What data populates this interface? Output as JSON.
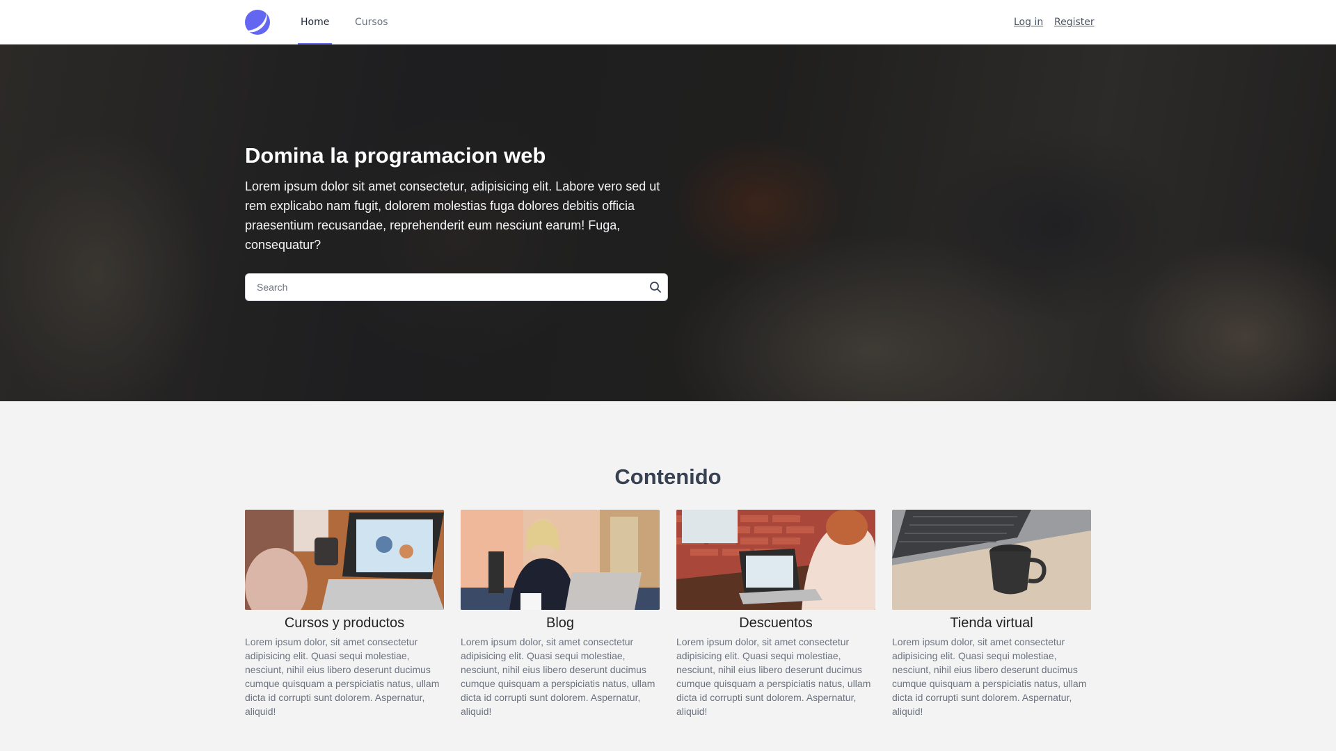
{
  "nav": {
    "items": [
      {
        "label": "Home",
        "active": true
      },
      {
        "label": "Cursos",
        "active": false
      }
    ],
    "login_label": "Log in",
    "register_label": "Register"
  },
  "hero": {
    "title": "Domina la programacion web",
    "description": "Lorem ipsum dolor sit amet consectetur, adipisicing elit. Labore vero sed ut rem explicabo nam fugit, dolorem molestias fuga dolores debitis officia praesentium recusandae, reprehenderit eum nesciunt earum! Fuga, consequatur?",
    "search": {
      "placeholder": "Search",
      "value": ""
    }
  },
  "content": {
    "title": "Contenido",
    "cards": [
      {
        "title": "Cursos y productos",
        "text": "Lorem ipsum dolor, sit amet consectetur adipisicing elit. Quasi sequi molestiae, nesciunt, nihil eius libero deserunt ducimus cumque quisquam a perspiciatis natus, ullam dicta id corrupti sunt dolorem. Aspernatur, aliquid!"
      },
      {
        "title": "Blog",
        "text": "Lorem ipsum dolor, sit amet consectetur adipisicing elit. Quasi sequi molestiae, nesciunt, nihil eius libero deserunt ducimus cumque quisquam a perspiciatis natus, ullam dicta id corrupti sunt dolorem. Aspernatur, aliquid!"
      },
      {
        "title": "Descuentos",
        "text": "Lorem ipsum dolor, sit amet consectetur adipisicing elit. Quasi sequi molestiae, nesciunt, nihil eius libero deserunt ducimus cumque quisquam a perspiciatis natus, ullam dicta id corrupti sunt dolorem. Aspernatur, aliquid!"
      },
      {
        "title": "Tienda virtual",
        "text": "Lorem ipsum dolor, sit amet consectetur adipisicing elit. Quasi sequi molestiae, nesciunt, nihil eius libero deserunt ducimus cumque quisquam a perspiciatis natus, ullam dicta id corrupti sunt dolorem. Aspernatur, aliquid!"
      }
    ]
  },
  "colors": {
    "accent": "#6366f1",
    "nav_background": "#ffffff",
    "page_background": "#f3f3f3"
  },
  "icons": {
    "logo": "logo-icon",
    "search": "search-icon"
  }
}
